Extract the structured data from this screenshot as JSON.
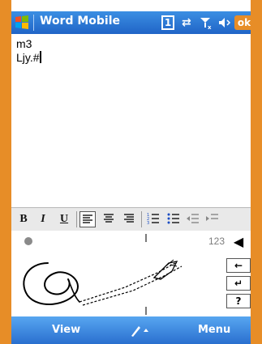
{
  "window": {
    "title": "Word Mobile"
  },
  "status": {
    "notif_number": "1",
    "ok_label": "ok"
  },
  "document": {
    "lines": [
      "m3",
      "Ljy.#"
    ]
  },
  "toolbar": {
    "bold": "B",
    "italic": "I",
    "underline": "U"
  },
  "input_panel": {
    "mode_label": "123"
  },
  "keys": {
    "back": "←",
    "enter": "↵",
    "question": "?"
  },
  "softkeys": {
    "left": "View",
    "right": "Menu"
  }
}
